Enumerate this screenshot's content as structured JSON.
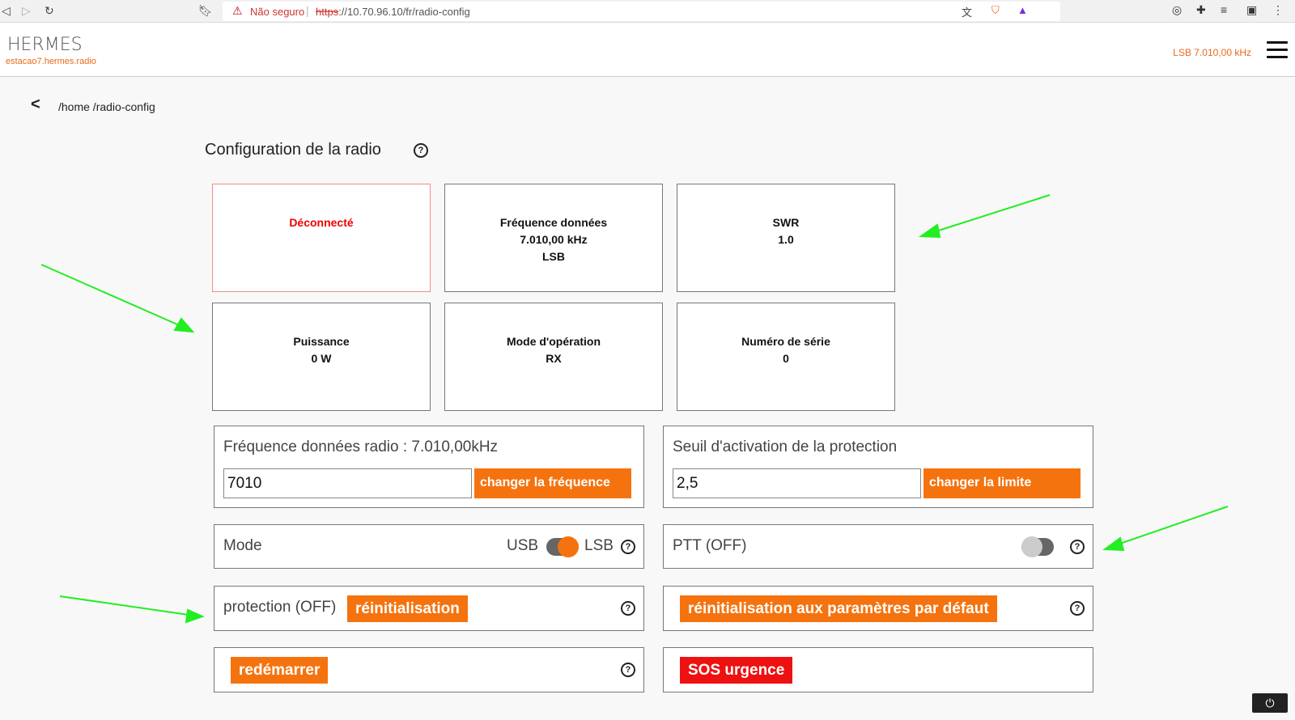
{
  "browser": {
    "not_secure": "Não seguro",
    "url_protocol": "https",
    "url_rest": "://10.70.96.10/fr/radio-config"
  },
  "header": {
    "logo": "HERMES",
    "station": "estacao7.hermes.radio",
    "frequency": "LSB 7.010,00 kHz"
  },
  "breadcrumb": "/home /radio-config",
  "page_title": "Configuration de la radio",
  "cards": {
    "status": "Déconnecté",
    "freq_title": "Fréquence données",
    "freq_value": "7.010,00 kHz",
    "freq_mode": "LSB",
    "swr_title": "SWR",
    "swr_value": "1.0",
    "power_title": "Puissance",
    "power_value": "0 W",
    "opmode_title": "Mode d'opération",
    "opmode_value": "RX",
    "serial_title": "Numéro de série",
    "serial_value": "0"
  },
  "frequency_panel": {
    "label": "Fréquence données radio : 7.010,00kHz",
    "input_value": "7010",
    "button": "changer la fréquence"
  },
  "threshold_panel": {
    "label": "Seuil d'activation de la protection",
    "input_value": "2,5",
    "button": "changer la limite"
  },
  "mode_panel": {
    "label": "Mode",
    "left": "USB",
    "right": "LSB",
    "selected": "LSB"
  },
  "ptt_panel": {
    "label": "PTT (OFF)",
    "state": "off"
  },
  "protection_panel": {
    "label": "protection (OFF)",
    "button": "réinitialisation"
  },
  "defaults_panel": {
    "button": "réinitialisation aux paramètres par défaut"
  },
  "restart_panel": {
    "button": "redémarrer"
  },
  "sos_panel": {
    "button": "SOS urgence"
  },
  "help_glyph": "?",
  "power_glyph": "⏻",
  "colors": {
    "accent": "#f5730f",
    "danger": "#ee1111",
    "annotation_arrow": "#22ee22"
  }
}
